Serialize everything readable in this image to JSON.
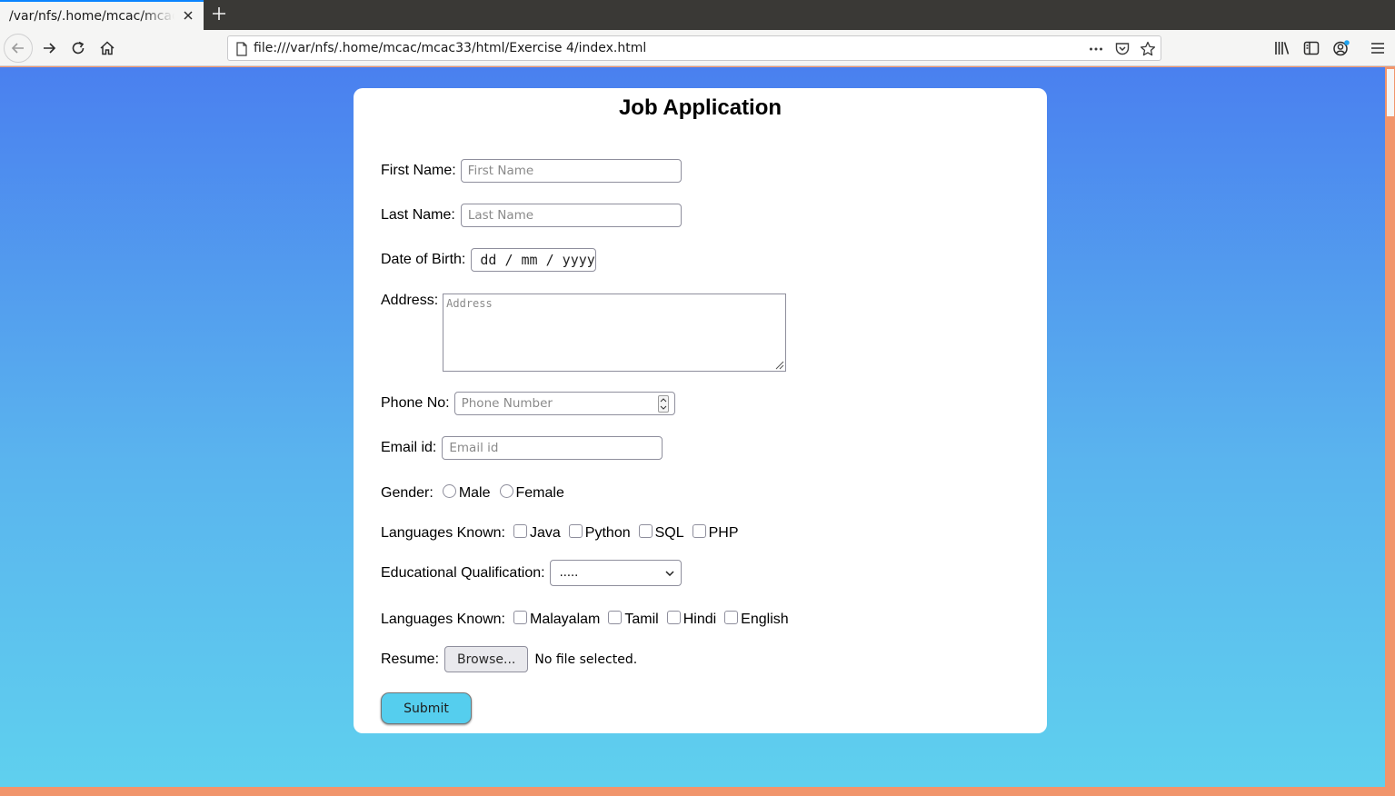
{
  "browser": {
    "tab_title": "/var/nfs/.home/mcac/mcac33/html/Exercise 4/index.html",
    "url": "file:///var/nfs/.home/mcac/mcac33/html/Exercise 4/index.html",
    "icons": [
      "back-icon",
      "forward-icon",
      "reload-icon",
      "home-icon",
      "page-icon",
      "more-icon",
      "pocket-icon",
      "bookmark-star-icon",
      "library-icon",
      "sidebar-icon",
      "account-icon",
      "menu-icon"
    ],
    "accent_color": "#0a84ff"
  },
  "page": {
    "background_top": "#4a80ef",
    "background_bottom": "#5fd0ee"
  },
  "form": {
    "title": "Job Application",
    "first_name": {
      "label": "First Name:",
      "placeholder": "First Name"
    },
    "last_name": {
      "label": "Last Name:",
      "placeholder": "Last Name"
    },
    "dob": {
      "label": "Date of Birth:",
      "placeholder": "dd / mm / yyyy"
    },
    "address": {
      "label": "Address:",
      "placeholder": "Address"
    },
    "phone": {
      "label": "Phone No:",
      "placeholder": "Phone Number"
    },
    "email": {
      "label": "Email id:",
      "placeholder": "Email id"
    },
    "gender": {
      "label": "Gender:",
      "options": [
        "Male",
        "Female"
      ]
    },
    "programming_languages": {
      "label": "Languages Known:",
      "options": [
        "Java",
        "Python",
        "SQL",
        "PHP"
      ]
    },
    "qualification": {
      "label": "Educational Qualification:",
      "selected": "....."
    },
    "spoken_languages": {
      "label": "Languages Known:",
      "options": [
        "Malayalam",
        "Tamil",
        "Hindi",
        "English"
      ]
    },
    "resume": {
      "label": "Resume:",
      "button": "Browse...",
      "status": "No file selected."
    },
    "submit": "Submit",
    "submit_color": "#55ceee"
  }
}
